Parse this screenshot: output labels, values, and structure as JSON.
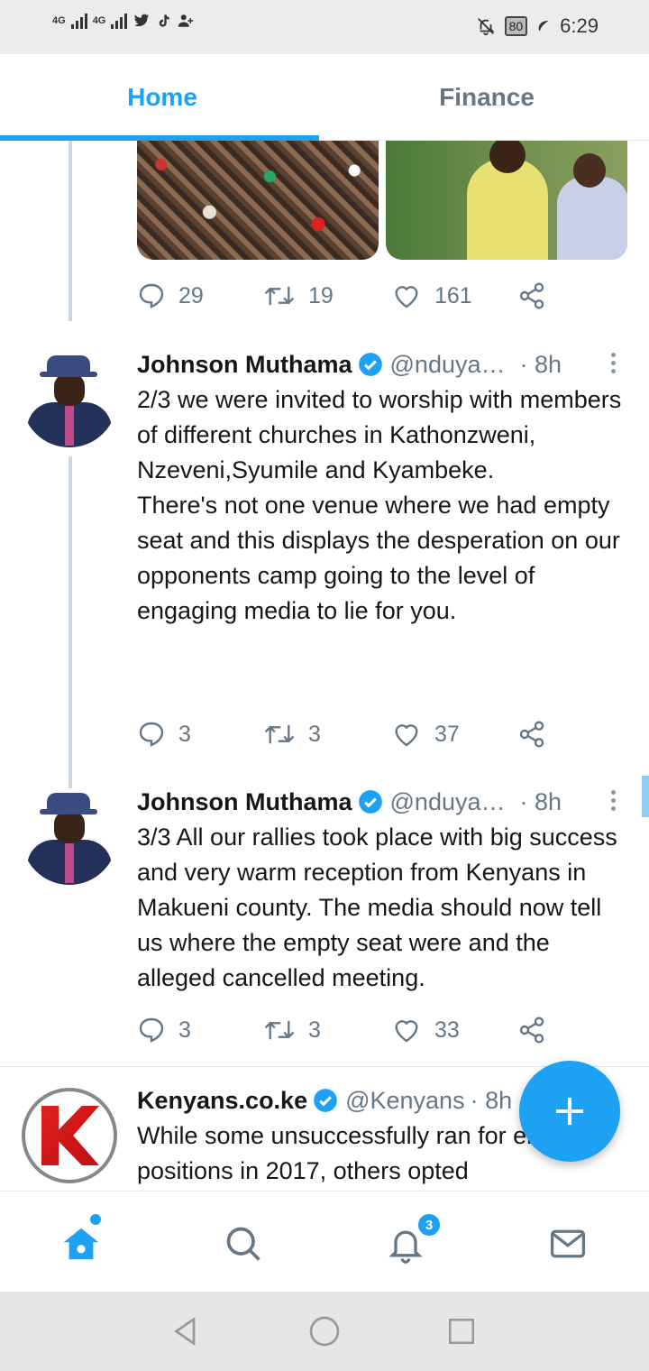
{
  "status_bar": {
    "network1": "4G",
    "network2": "4G",
    "battery": "80",
    "time": "6:29",
    "icons": [
      "signal-icon",
      "twitter-icon",
      "tiktok-icon",
      "add-person-icon",
      "mute-icon",
      "leaf-icon"
    ]
  },
  "tabs": [
    {
      "label": "Home",
      "active": true
    },
    {
      "label": "Finance",
      "active": false
    }
  ],
  "colors": {
    "accent": "#1da1f2",
    "muted": "#657786",
    "text": "#14171a"
  },
  "prev_tweet": {
    "reply_count": "29",
    "retweet_count": "19",
    "like_count": "161"
  },
  "tweets": [
    {
      "name": "Johnson Muthama",
      "handle": "@nduya…",
      "time": "· 8h",
      "body": "2/3 we were invited to worship with members of different churches in Kathonzweni, Nzeveni,Syumile and Kyambeke.\nThere's not one venue where we had empty seat and this displays the desperation on our opponents camp going to the level of engaging media to lie for  you.",
      "reply_count": "3",
      "retweet_count": "3",
      "like_count": "37"
    },
    {
      "name": "Johnson Muthama",
      "handle": "@nduya…",
      "time": "· 8h",
      "body": "3/3 All our rallies took place with big success and very warm reception from Kenyans in Makueni county. The media should now tell us where the empty seat were and the alleged cancelled meeting.",
      "reply_count": "3",
      "retweet_count": "3",
      "like_count": "33"
    },
    {
      "name": "Kenyans.co.ke",
      "handle": "@Kenyans",
      "time": "· 8h",
      "body": "While some unsuccessfully ran for elective positions in 2017, others opted"
    }
  ],
  "bottom_nav": {
    "items": [
      "home-icon",
      "search-icon",
      "notifications-icon",
      "messages-icon"
    ],
    "notification_badge": "3"
  },
  "system_nav": [
    "back-icon",
    "home-circle-icon",
    "recents-icon"
  ]
}
